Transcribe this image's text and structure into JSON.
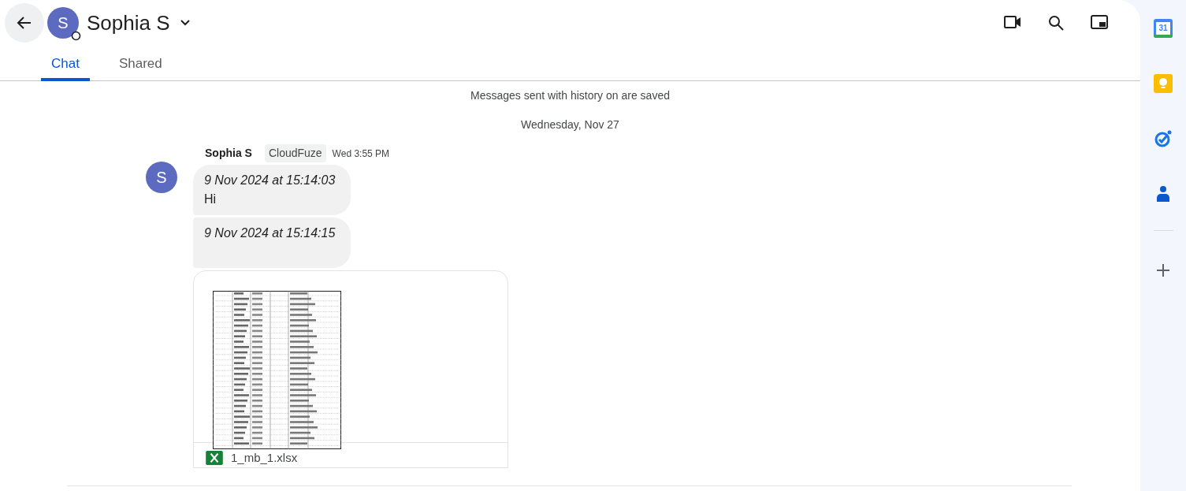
{
  "header": {
    "title": "Sophia S",
    "avatar_letter": "S"
  },
  "tabs": [
    {
      "label": "Chat",
      "selected": true
    },
    {
      "label": "Shared",
      "selected": false
    }
  ],
  "history_notice": "Messages sent with history on are saved",
  "date_divider": "Wednesday, Nov 27",
  "message_group": {
    "sender": "Sophia S",
    "avatar_letter": "S",
    "tag": "CloudFuze",
    "time": "Wed 3:55 PM",
    "messages": [
      {
        "kind": "text",
        "timestamp": "9 Nov 2024 at 15:14:03",
        "body": "Hi"
      },
      {
        "kind": "text",
        "timestamp": "9 Nov 2024 at 15:14:15"
      },
      {
        "kind": "attachment",
        "file_name": "1_mb_1.xlsx"
      }
    ]
  },
  "side_panel": {
    "calendar_day": "31"
  }
}
